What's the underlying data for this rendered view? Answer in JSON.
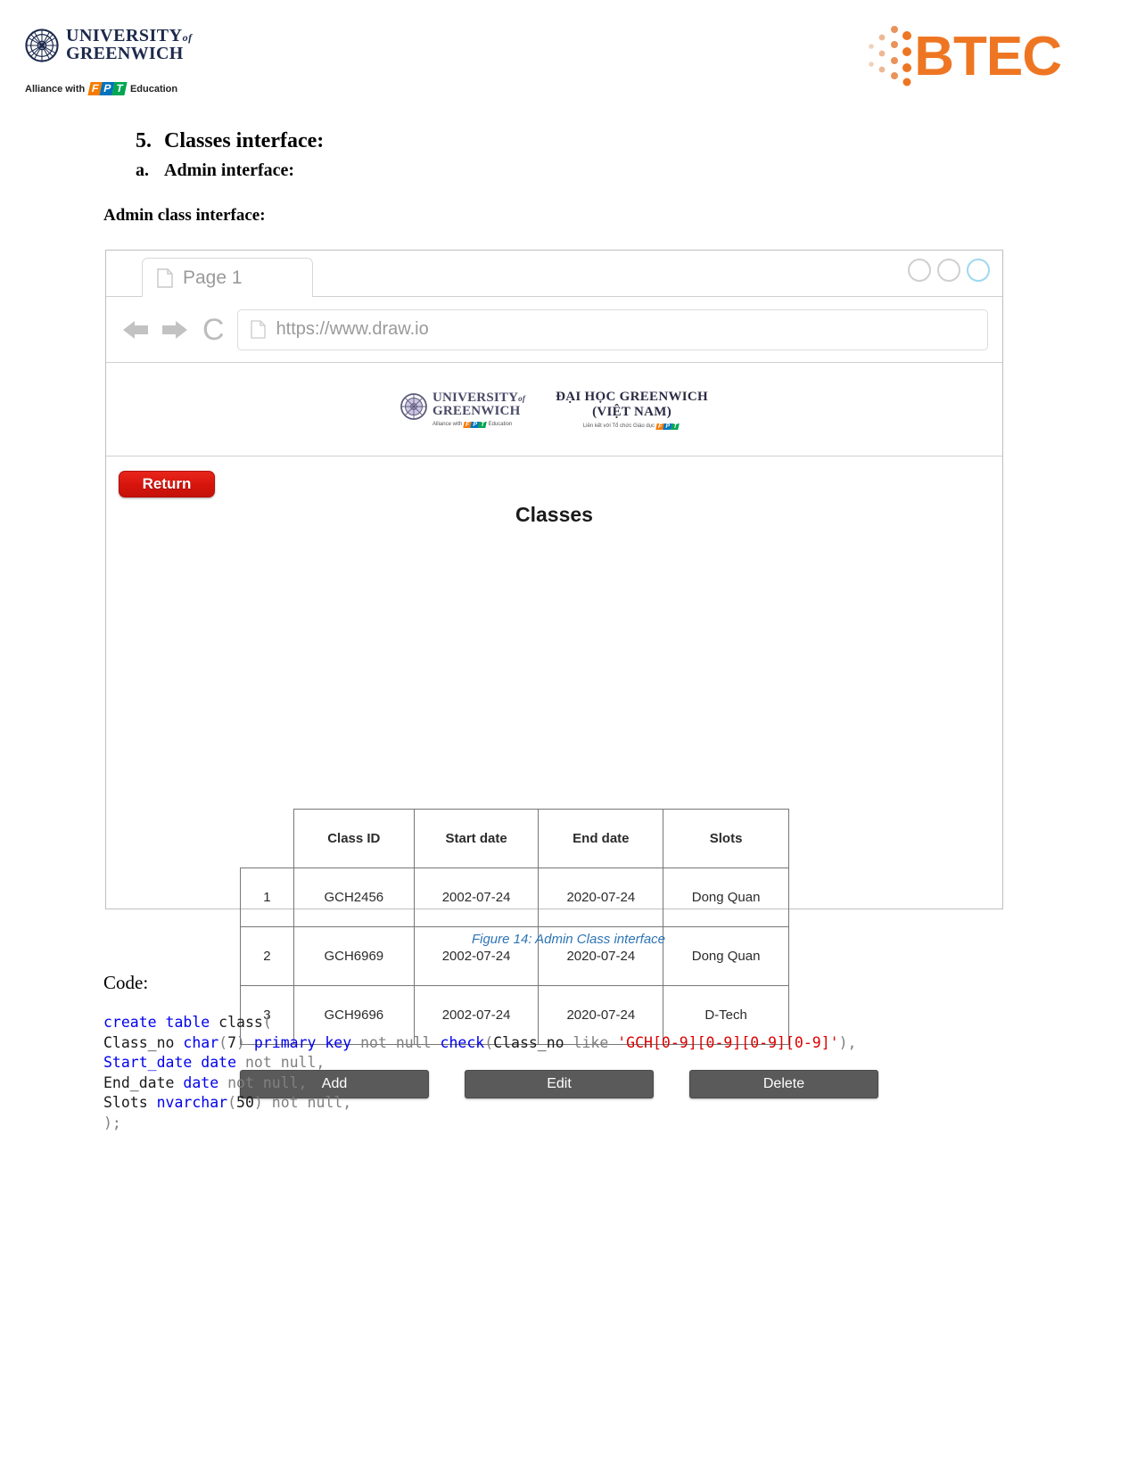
{
  "page_header": {
    "university_logo": {
      "icon": "university-seal-icon",
      "line1": "UNIVERSITY",
      "line1_suffix": "of",
      "line2": "GREENWICH",
      "alliance_prefix": "Alliance with",
      "alliance_brand": [
        "F",
        "P",
        "T"
      ],
      "alliance_suffix": "Education"
    },
    "btec_logo": {
      "icon": "btec-dots-icon",
      "wordmark": "BTEC",
      "color": "#ee7623"
    }
  },
  "headings": {
    "section_number": "5.",
    "section_title": "Classes interface:",
    "subsection_number": "a.",
    "subsection_title": "Admin interface:",
    "body_heading": "Admin class interface:"
  },
  "mockup": {
    "tab": {
      "icon": "document-icon",
      "label": "Page 1"
    },
    "window_controls": [
      "minimize-circle",
      "maximize-circle",
      "close-circle"
    ],
    "toolbar": {
      "back_icon": "arrow-left-icon",
      "forward_icon": "arrow-right-icon",
      "reload_icon": "reload-icon",
      "url_icon": "document-icon",
      "url": "https://www.draw.io"
    },
    "app_banner": {
      "uog_line1": "UNIVERSITY",
      "uog_line1_suffix": "of",
      "uog_line2": "GREENWICH",
      "uog_alliance_prefix": "Alliance with",
      "uog_alliance_suffix": "Education",
      "vn_line1": "ĐẠI HỌC GREENWICH",
      "vn_line2": "(VIỆT NAM)",
      "vn_alliance": "Liên kết với Tổ chức Giáo dục"
    },
    "app": {
      "return_label": "Return",
      "title": "Classes",
      "table": {
        "columns": [
          "",
          "Class ID",
          "Start date",
          "End date",
          "Slots"
        ],
        "rows": [
          {
            "index": "1",
            "class_id": "GCH2456",
            "start_date": "2002-07-24",
            "end_date": "2020-07-24",
            "slots": "Dong Quan"
          },
          {
            "index": "2",
            "class_id": "GCH6969",
            "start_date": "2002-07-24",
            "end_date": "2020-07-24",
            "slots": "Dong Quan"
          },
          {
            "index": "3",
            "class_id": "GCH9696",
            "start_date": "2002-07-24",
            "end_date": "2020-07-24",
            "slots": "D-Tech"
          }
        ]
      },
      "buttons": [
        "Add",
        "Edit",
        "Delete"
      ]
    }
  },
  "figure": {
    "caption": "Figure 14: Admin Class interface",
    "caption_color": "#2e74b5"
  },
  "code_section": {
    "label": "Code:",
    "lines": [
      "create table class(",
      "Class_no char(7) primary key not null check(Class_no like 'GCH[0-9][0-9][0-9][0-9]'),",
      "Start_date date not null,",
      "End_date date not null,",
      "Slots nvarchar(50) not null,",
      ");"
    ]
  }
}
